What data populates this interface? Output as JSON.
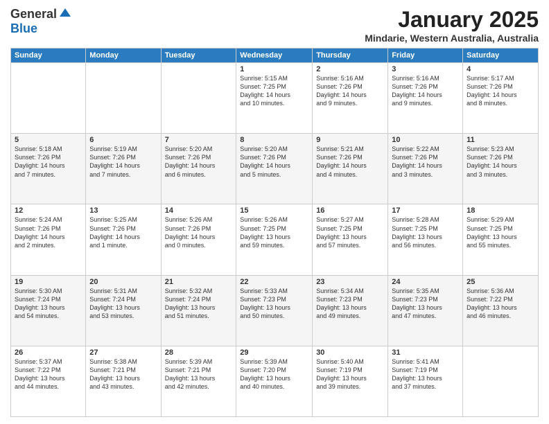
{
  "header": {
    "logo_line1": "General",
    "logo_line2": "Blue",
    "main_title": "January 2025",
    "subtitle": "Mindarie, Western Australia, Australia"
  },
  "weekdays": [
    "Sunday",
    "Monday",
    "Tuesday",
    "Wednesday",
    "Thursday",
    "Friday",
    "Saturday"
  ],
  "weeks": [
    [
      {
        "day": "",
        "info": ""
      },
      {
        "day": "",
        "info": ""
      },
      {
        "day": "",
        "info": ""
      },
      {
        "day": "1",
        "info": "Sunrise: 5:15 AM\nSunset: 7:25 PM\nDaylight: 14 hours\nand 10 minutes."
      },
      {
        "day": "2",
        "info": "Sunrise: 5:16 AM\nSunset: 7:26 PM\nDaylight: 14 hours\nand 9 minutes."
      },
      {
        "day": "3",
        "info": "Sunrise: 5:16 AM\nSunset: 7:26 PM\nDaylight: 14 hours\nand 9 minutes."
      },
      {
        "day": "4",
        "info": "Sunrise: 5:17 AM\nSunset: 7:26 PM\nDaylight: 14 hours\nand 8 minutes."
      }
    ],
    [
      {
        "day": "5",
        "info": "Sunrise: 5:18 AM\nSunset: 7:26 PM\nDaylight: 14 hours\nand 7 minutes."
      },
      {
        "day": "6",
        "info": "Sunrise: 5:19 AM\nSunset: 7:26 PM\nDaylight: 14 hours\nand 7 minutes."
      },
      {
        "day": "7",
        "info": "Sunrise: 5:20 AM\nSunset: 7:26 PM\nDaylight: 14 hours\nand 6 minutes."
      },
      {
        "day": "8",
        "info": "Sunrise: 5:20 AM\nSunset: 7:26 PM\nDaylight: 14 hours\nand 5 minutes."
      },
      {
        "day": "9",
        "info": "Sunrise: 5:21 AM\nSunset: 7:26 PM\nDaylight: 14 hours\nand 4 minutes."
      },
      {
        "day": "10",
        "info": "Sunrise: 5:22 AM\nSunset: 7:26 PM\nDaylight: 14 hours\nand 3 minutes."
      },
      {
        "day": "11",
        "info": "Sunrise: 5:23 AM\nSunset: 7:26 PM\nDaylight: 14 hours\nand 3 minutes."
      }
    ],
    [
      {
        "day": "12",
        "info": "Sunrise: 5:24 AM\nSunset: 7:26 PM\nDaylight: 14 hours\nand 2 minutes."
      },
      {
        "day": "13",
        "info": "Sunrise: 5:25 AM\nSunset: 7:26 PM\nDaylight: 14 hours\nand 1 minute."
      },
      {
        "day": "14",
        "info": "Sunrise: 5:26 AM\nSunset: 7:26 PM\nDaylight: 14 hours\nand 0 minutes."
      },
      {
        "day": "15",
        "info": "Sunrise: 5:26 AM\nSunset: 7:25 PM\nDaylight: 13 hours\nand 59 minutes."
      },
      {
        "day": "16",
        "info": "Sunrise: 5:27 AM\nSunset: 7:25 PM\nDaylight: 13 hours\nand 57 minutes."
      },
      {
        "day": "17",
        "info": "Sunrise: 5:28 AM\nSunset: 7:25 PM\nDaylight: 13 hours\nand 56 minutes."
      },
      {
        "day": "18",
        "info": "Sunrise: 5:29 AM\nSunset: 7:25 PM\nDaylight: 13 hours\nand 55 minutes."
      }
    ],
    [
      {
        "day": "19",
        "info": "Sunrise: 5:30 AM\nSunset: 7:24 PM\nDaylight: 13 hours\nand 54 minutes."
      },
      {
        "day": "20",
        "info": "Sunrise: 5:31 AM\nSunset: 7:24 PM\nDaylight: 13 hours\nand 53 minutes."
      },
      {
        "day": "21",
        "info": "Sunrise: 5:32 AM\nSunset: 7:24 PM\nDaylight: 13 hours\nand 51 minutes."
      },
      {
        "day": "22",
        "info": "Sunrise: 5:33 AM\nSunset: 7:23 PM\nDaylight: 13 hours\nand 50 minutes."
      },
      {
        "day": "23",
        "info": "Sunrise: 5:34 AM\nSunset: 7:23 PM\nDaylight: 13 hours\nand 49 minutes."
      },
      {
        "day": "24",
        "info": "Sunrise: 5:35 AM\nSunset: 7:23 PM\nDaylight: 13 hours\nand 47 minutes."
      },
      {
        "day": "25",
        "info": "Sunrise: 5:36 AM\nSunset: 7:22 PM\nDaylight: 13 hours\nand 46 minutes."
      }
    ],
    [
      {
        "day": "26",
        "info": "Sunrise: 5:37 AM\nSunset: 7:22 PM\nDaylight: 13 hours\nand 44 minutes."
      },
      {
        "day": "27",
        "info": "Sunrise: 5:38 AM\nSunset: 7:21 PM\nDaylight: 13 hours\nand 43 minutes."
      },
      {
        "day": "28",
        "info": "Sunrise: 5:39 AM\nSunset: 7:21 PM\nDaylight: 13 hours\nand 42 minutes."
      },
      {
        "day": "29",
        "info": "Sunrise: 5:39 AM\nSunset: 7:20 PM\nDaylight: 13 hours\nand 40 minutes."
      },
      {
        "day": "30",
        "info": "Sunrise: 5:40 AM\nSunset: 7:19 PM\nDaylight: 13 hours\nand 39 minutes."
      },
      {
        "day": "31",
        "info": "Sunrise: 5:41 AM\nSunset: 7:19 PM\nDaylight: 13 hours\nand 37 minutes."
      },
      {
        "day": "",
        "info": ""
      }
    ]
  ]
}
